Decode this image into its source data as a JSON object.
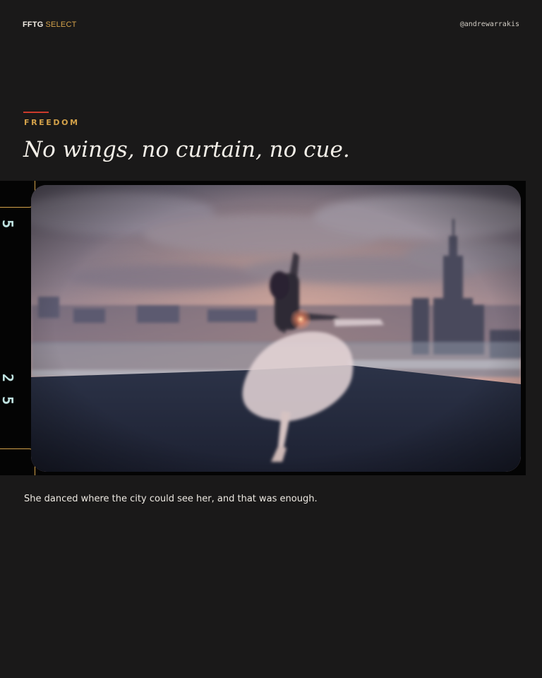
{
  "header": {
    "brand_strong": "FFTG",
    "brand_accent": "SELECT",
    "handle": "@andrewarrakis"
  },
  "article": {
    "kicker": "FREEDOM",
    "headline": "No wings, no curtain, no cue.",
    "caption": "She danced where the city could see her, and that was enough."
  },
  "film": {
    "frame_numbers": [
      "5",
      "2",
      "5"
    ]
  },
  "colors": {
    "background": "#1a1919",
    "accent_gold": "#d4a24a",
    "accent_red": "#cc3a2c",
    "film_black": "#040404",
    "frame_number": "#bfe2e0"
  }
}
